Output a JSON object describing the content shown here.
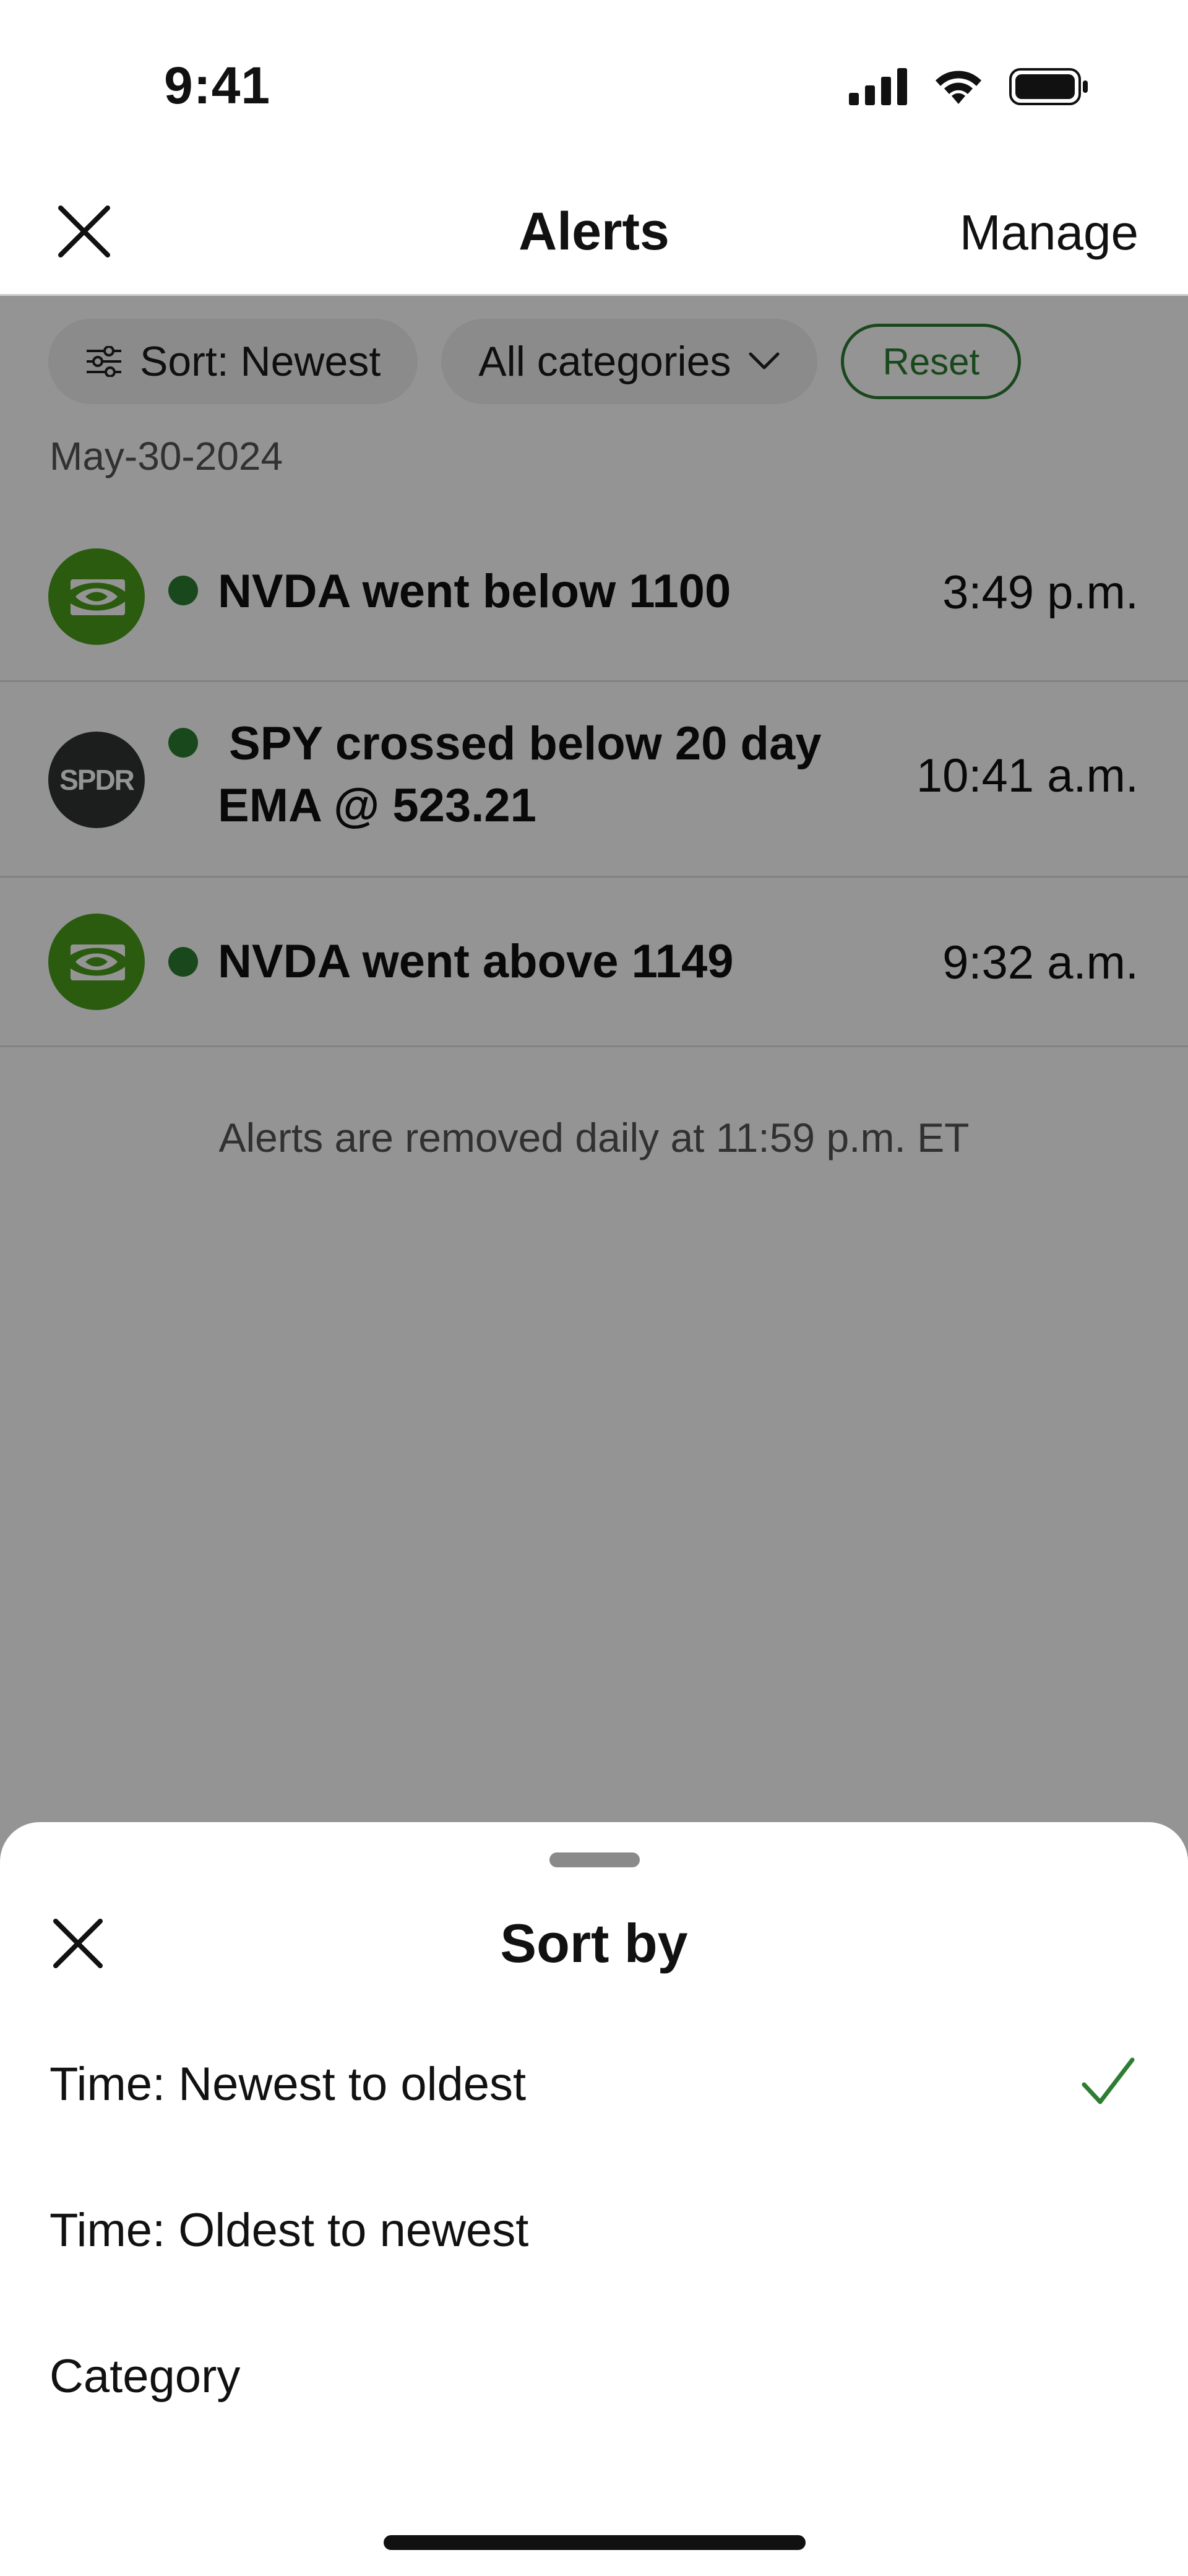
{
  "status_bar": {
    "time": "9:41"
  },
  "nav": {
    "title": "Alerts",
    "manage_label": "Manage"
  },
  "filters": {
    "sort_label": "Sort: Newest",
    "category_label": "All categories",
    "reset_label": "Reset"
  },
  "date_group": "May-30-2024",
  "alerts": [
    {
      "logo": "nvidia-logo",
      "text": "NVDA went below 1100",
      "time": "3:49 p.m."
    },
    {
      "logo": "spdr-logo",
      "logo_text": "SPDR",
      "text_line1": "SPY crossed below 20 day",
      "text_line2": "EMA @ 523.21",
      "time": "10:41 a.m."
    },
    {
      "logo": "nvidia-logo",
      "text": "NVDA went above 1149",
      "time": "9:32 a.m."
    }
  ],
  "footer_note": "Alerts are removed daily at 11:59 p.m. ET",
  "sort_sheet": {
    "title": "Sort by",
    "options": [
      {
        "label": "Time: Newest to oldest",
        "selected": true
      },
      {
        "label": "Time: Oldest to newest",
        "selected": false
      },
      {
        "label": "Category",
        "selected": false
      }
    ]
  },
  "colors": {
    "accent_green": "#2e7d32",
    "nvidia_green": "#4a9e1a",
    "spdr_dark": "#2f3432",
    "overlay": "rgba(0,0,0,0.42)"
  }
}
